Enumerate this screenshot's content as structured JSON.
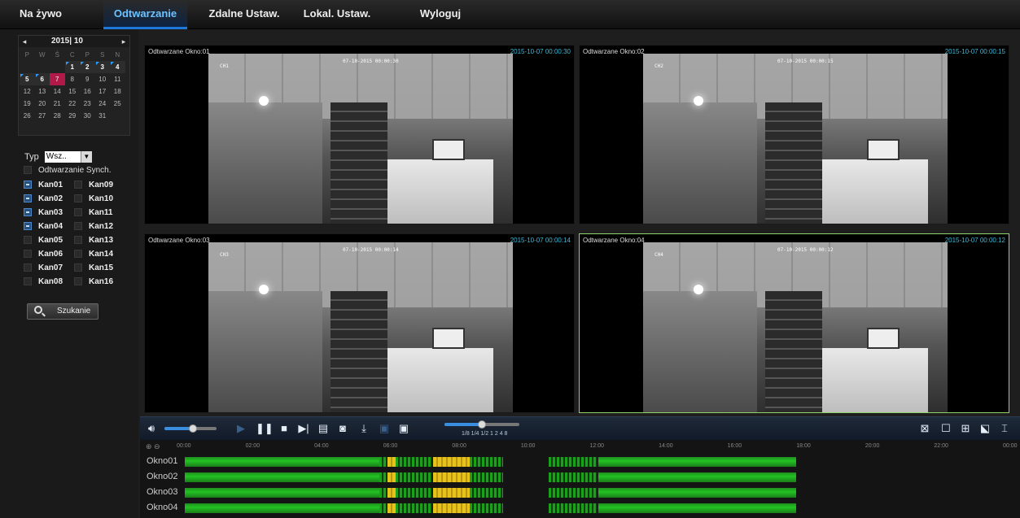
{
  "nav": {
    "tabs": [
      {
        "label": "Na żywo"
      },
      {
        "label": "Odtwarzanie"
      },
      {
        "label": "Zdalne Ustaw."
      },
      {
        "label": "Lokal. Ustaw."
      },
      {
        "label": "Wyloguj"
      }
    ],
    "active": "Odtwarzanie"
  },
  "calendar": {
    "year_month": "2015| 10",
    "prev_icon": "◂",
    "next_icon": "▸",
    "weekdays": [
      "P",
      "W",
      "Ś",
      "C",
      "P",
      "S",
      "N"
    ],
    "days": [
      {
        "d": "",
        "cls": ""
      },
      {
        "d": "",
        "cls": ""
      },
      {
        "d": "",
        "cls": ""
      },
      {
        "d": "1",
        "cls": "rec"
      },
      {
        "d": "2",
        "cls": "rec"
      },
      {
        "d": "3",
        "cls": "rec"
      },
      {
        "d": "4",
        "cls": "rec"
      },
      {
        "d": "5",
        "cls": "rec"
      },
      {
        "d": "6",
        "cls": "rec"
      },
      {
        "d": "7",
        "cls": "sel"
      },
      {
        "d": "8",
        "cls": ""
      },
      {
        "d": "9",
        "cls": ""
      },
      {
        "d": "10",
        "cls": ""
      },
      {
        "d": "11",
        "cls": ""
      },
      {
        "d": "12",
        "cls": ""
      },
      {
        "d": "13",
        "cls": ""
      },
      {
        "d": "14",
        "cls": ""
      },
      {
        "d": "15",
        "cls": ""
      },
      {
        "d": "16",
        "cls": ""
      },
      {
        "d": "17",
        "cls": ""
      },
      {
        "d": "18",
        "cls": ""
      },
      {
        "d": "19",
        "cls": ""
      },
      {
        "d": "20",
        "cls": ""
      },
      {
        "d": "21",
        "cls": ""
      },
      {
        "d": "22",
        "cls": ""
      },
      {
        "d": "23",
        "cls": ""
      },
      {
        "d": "24",
        "cls": ""
      },
      {
        "d": "25",
        "cls": ""
      },
      {
        "d": "26",
        "cls": ""
      },
      {
        "d": "27",
        "cls": ""
      },
      {
        "d": "28",
        "cls": ""
      },
      {
        "d": "29",
        "cls": ""
      },
      {
        "d": "30",
        "cls": ""
      },
      {
        "d": "31",
        "cls": ""
      }
    ]
  },
  "filter": {
    "typ_label": "Typ",
    "typ_value": "Wsz..",
    "sync_label": "Odtwarzanie Synch."
  },
  "channels": [
    {
      "label": "Kan01",
      "checked": true
    },
    {
      "label": "Kan09",
      "checked": false
    },
    {
      "label": "Kan02",
      "checked": true
    },
    {
      "label": "Kan10",
      "checked": false
    },
    {
      "label": "Kan03",
      "checked": true
    },
    {
      "label": "Kan11",
      "checked": false
    },
    {
      "label": "Kan04",
      "checked": true
    },
    {
      "label": "Kan12",
      "checked": false
    },
    {
      "label": "Kan05",
      "checked": false
    },
    {
      "label": "Kan13",
      "checked": false
    },
    {
      "label": "Kan06",
      "checked": false
    },
    {
      "label": "Kan14",
      "checked": false
    },
    {
      "label": "Kan07",
      "checked": false
    },
    {
      "label": "Kan15",
      "checked": false
    },
    {
      "label": "Kan08",
      "checked": false
    },
    {
      "label": "Kan16",
      "checked": false
    }
  ],
  "search_button": "Szukanie",
  "videos": [
    {
      "title": "Odtwarzane Okno:01",
      "time": "2015-10-07 00:00:30",
      "osd": "07-10-2015 00:00:30",
      "ch": "CH1",
      "active": false
    },
    {
      "title": "Odtwarzane Okno:02",
      "time": "2015-10-07 00:00:15",
      "osd": "07-10-2015 00:00:15",
      "ch": "CH2",
      "active": false
    },
    {
      "title": "Odtwarzane Okno:03",
      "time": "2015-10-07 00:00:14",
      "osd": "07-10-2015 00:00:14",
      "ch": "CH3",
      "active": false
    },
    {
      "title": "Odtwarzane Okno:04",
      "time": "2015-10-07 00:00:12",
      "osd": "07-10-2015 00:00:12",
      "ch": "CH4",
      "active": true
    }
  ],
  "controls": {
    "speed_labels": "1/8  1/4  1/2  1   2   4   8",
    "volume_level": 0.55,
    "speed_level": 0.5
  },
  "timeline": {
    "hours": [
      "00:00",
      "02:00",
      "04:00",
      "06:00",
      "08:00",
      "10:00",
      "12:00",
      "14:00",
      "16:00",
      "18:00",
      "20:00",
      "22:00",
      "00:00"
    ],
    "rows": [
      "Okno01",
      "Okno02",
      "Okno03",
      "Okno04"
    ]
  },
  "colors": {
    "accent": "#1e78d8",
    "active_border": "#8fd36b",
    "record_green": "#22c322",
    "alarm_yellow": "#e6c21a",
    "selected_day": "#b01948"
  }
}
